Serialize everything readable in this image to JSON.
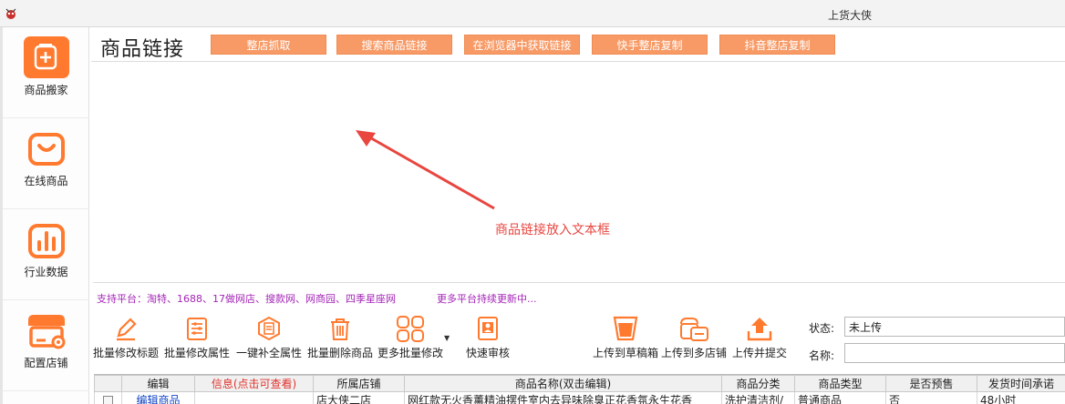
{
  "window": {
    "title": "上货大侠"
  },
  "sidebar": {
    "items": [
      {
        "label": "商品搬家",
        "icon": "plus-box-icon"
      },
      {
        "label": "在线商品",
        "icon": "shopping-bag-icon"
      },
      {
        "label": "行业数据",
        "icon": "bar-chart-icon"
      },
      {
        "label": "配置店铺",
        "icon": "store-gear-icon"
      }
    ]
  },
  "header": {
    "title": "商品链接",
    "buttons": [
      "整店抓取",
      "搜索商品链接",
      "在浏览器中获取链接",
      "快手整店复制",
      "抖音整店复制"
    ]
  },
  "link_box": {
    "hint": "商品链接放入文本框"
  },
  "platforms": {
    "supported": "支持平台：淘特、1688、17做网店、搜款网、网商园、四季星座网",
    "more": "更多平台持续更新中..."
  },
  "toolbar": {
    "left": [
      {
        "label": "批量修改标题",
        "icon": "pencil-icon"
      },
      {
        "label": "批量修改属性",
        "icon": "sliders-doc-icon"
      },
      {
        "label": "一键补全属性",
        "icon": "hexagon-doc-icon"
      },
      {
        "label": "批量删除商品",
        "icon": "trash-icon"
      },
      {
        "label": "更多批量修改",
        "icon": "grid-more-icon"
      },
      {
        "label": "快速审核",
        "icon": "review-icon"
      }
    ],
    "right": [
      {
        "label": "上传到草稿箱",
        "icon": "draft-cup-icon"
      },
      {
        "label": "上传到多店铺",
        "icon": "multi-store-icon"
      },
      {
        "label": "上传并提交",
        "icon": "upload-icon"
      }
    ]
  },
  "filters": {
    "status_label": "状态:",
    "status_value": "未上传",
    "name_label": "名称:",
    "name_value": ""
  },
  "table": {
    "columns": [
      "编辑",
      "信息(点击可查看)",
      "所属店铺",
      "商品名称(双击编辑)",
      "商品分类",
      "商品类型",
      "是否预售",
      "发货时间承诺"
    ],
    "rows": [
      {
        "edit": "编辑商品",
        "info": "",
        "store": "店大侠二店",
        "name": "网红款无火香薰精油摆件室内去异味除臭正花香氛永生花香",
        "category": "洗护清洁剂/",
        "type": "普通商品",
        "presale": "否",
        "ship": "48小时"
      }
    ]
  },
  "colors": {
    "accent": "#ff7a2f",
    "button": "#f79a66",
    "hint": "#e8463f",
    "platform": "#a426b7",
    "link": "#1144c8"
  }
}
